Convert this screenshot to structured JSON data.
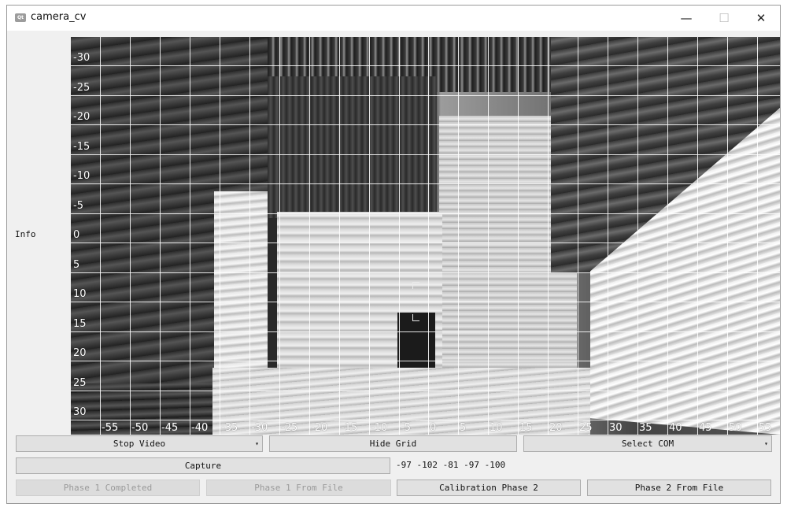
{
  "window": {
    "title": "camera_cv",
    "app_icon": "qt-icon",
    "controls": {
      "minimize": "—",
      "maximize": "☐",
      "close": "✕"
    }
  },
  "info_label": "Info",
  "video": {
    "description": "live camera feed of anechoic chamber with overlay grid",
    "grid_visible": true,
    "y_ticks": [
      "-30",
      "-25",
      "-20",
      "-15",
      "-10",
      "-5",
      "0",
      "5",
      "10",
      "15",
      "20",
      "25",
      "30"
    ],
    "x_ticks": [
      "-55",
      "-50",
      "-45",
      "-40",
      "-35",
      "-30",
      "-25",
      "-20",
      "-15",
      "-10",
      "-5",
      "0",
      "5",
      "10",
      "15",
      "20",
      "25",
      "30",
      "35",
      "40",
      "45",
      "50",
      "55"
    ]
  },
  "controls": {
    "video_select": {
      "label": "Stop Video",
      "arrow": "▾"
    },
    "grid_button": "Hide Grid",
    "com_select": {
      "label": "Select COM",
      "arrow": "▾"
    },
    "capture_button": "Capture",
    "readout": "-97 -102 -81 -97 -100",
    "phase1_completed": "Phase 1 Completed",
    "phase1_from_file": "Phase 1 From File",
    "calibration_phase2": "Calibration Phase 2",
    "phase2_from_file": "Phase 2 From File"
  }
}
